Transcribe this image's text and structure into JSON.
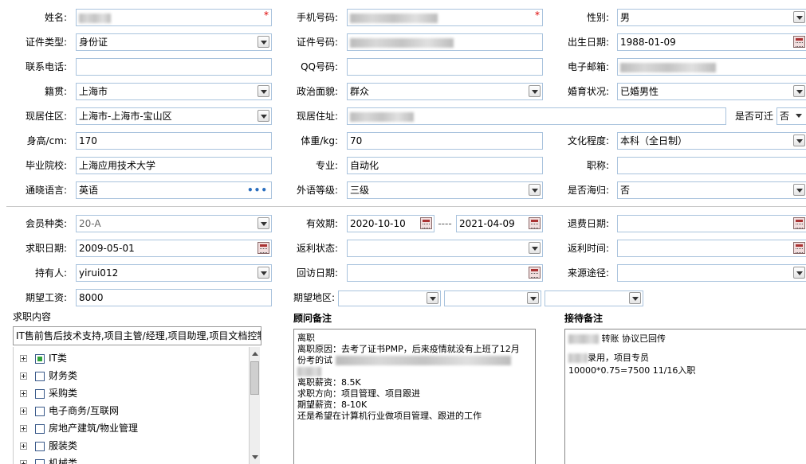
{
  "form": {
    "name": {
      "label": "姓名:",
      "required": "*"
    },
    "mobile": {
      "label": "手机号码:",
      "required": "*"
    },
    "gender": {
      "label": "性别:",
      "value": "男"
    },
    "id_type": {
      "label": "证件类型:",
      "value": "身份证"
    },
    "id_no": {
      "label": "证件号码:"
    },
    "birth": {
      "label": "出生日期:",
      "value": "1988-01-09"
    },
    "phone": {
      "label": "联系电话:",
      "value": ""
    },
    "qq": {
      "label": "QQ号码:",
      "value": ""
    },
    "email": {
      "label": "电子邮箱:"
    },
    "native": {
      "label": "籍贯:",
      "value": "上海市"
    },
    "politics": {
      "label": "政治面貌:",
      "value": "群众"
    },
    "marriage": {
      "label": "婚育状况:",
      "value": "已婚男性"
    },
    "residence": {
      "label": "现居住区:",
      "value": "上海市-上海市-宝山区"
    },
    "address": {
      "label": "现居住址:"
    },
    "relocate": {
      "label": "是否可迁",
      "value": "否"
    },
    "height": {
      "label": "身高/cm:",
      "value": "170"
    },
    "weight": {
      "label": "体重/kg:",
      "value": "70"
    },
    "education": {
      "label": "文化程度:",
      "value": "本科（全日制）"
    },
    "school": {
      "label": "毕业院校:",
      "value": "上海应用技术大学"
    },
    "major": {
      "label": "专业:",
      "value": "自动化"
    },
    "title": {
      "label": "职称:",
      "value": ""
    },
    "language": {
      "label": "通晓语言:",
      "value": "英语",
      "more": "•••"
    },
    "lang_level": {
      "label": "外语等级:",
      "value": "三级"
    },
    "overseas": {
      "label": "是否海归:",
      "value": "否"
    },
    "member_type": {
      "label": "会员种类:",
      "value": "20-A"
    },
    "valid": {
      "label": "有效期:",
      "from": "2020-10-10",
      "dash": "----",
      "to": "2021-04-09"
    },
    "refund_date": {
      "label": "退费日期:",
      "value": ""
    },
    "job_date": {
      "label": "求职日期:",
      "value": "2009-05-01"
    },
    "rebate_status": {
      "label": "返利状态:",
      "value": ""
    },
    "rebate_time": {
      "label": "返利时间:",
      "value": ""
    },
    "holder": {
      "label": "持有人:",
      "value": "yirui012"
    },
    "visit_date": {
      "label": "回访日期:",
      "value": ""
    },
    "source": {
      "label": "来源途径:",
      "value": ""
    },
    "salary": {
      "label": "期望工资:",
      "value": "8000"
    },
    "region": {
      "label": "期望地区:"
    }
  },
  "job_content": {
    "title": "求职内容",
    "summary": "IT售前售后技术支持,项目主管/经理,项目助理,项目文档控制",
    "tree": [
      {
        "label": "IT类",
        "checked": true
      },
      {
        "label": "财务类",
        "checked": false
      },
      {
        "label": "采购类",
        "checked": false
      },
      {
        "label": "电子商务/互联网",
        "checked": false
      },
      {
        "label": "房地产建筑/物业管理",
        "checked": false
      },
      {
        "label": "服装类",
        "checked": false
      },
      {
        "label": "机械类",
        "checked": false
      }
    ]
  },
  "consultant_notes": {
    "title": "顾问备注",
    "lines": [
      "离职",
      "离职原因：去考了证书PMP，后来疫情就没有上班了12月",
      "份考的试",
      "离职薪资：8.5K",
      "求职方向：项目管理、项目跟进",
      "期望薪资：8-10K",
      "还是希望在计算机行业做项目管理、跟进的工作"
    ]
  },
  "reception_notes": {
    "title": "接待备注",
    "line1": "转账 协议已回传",
    "line2": "录用，项目专员",
    "line3": "10000*0.75=7500  11/16入职"
  }
}
